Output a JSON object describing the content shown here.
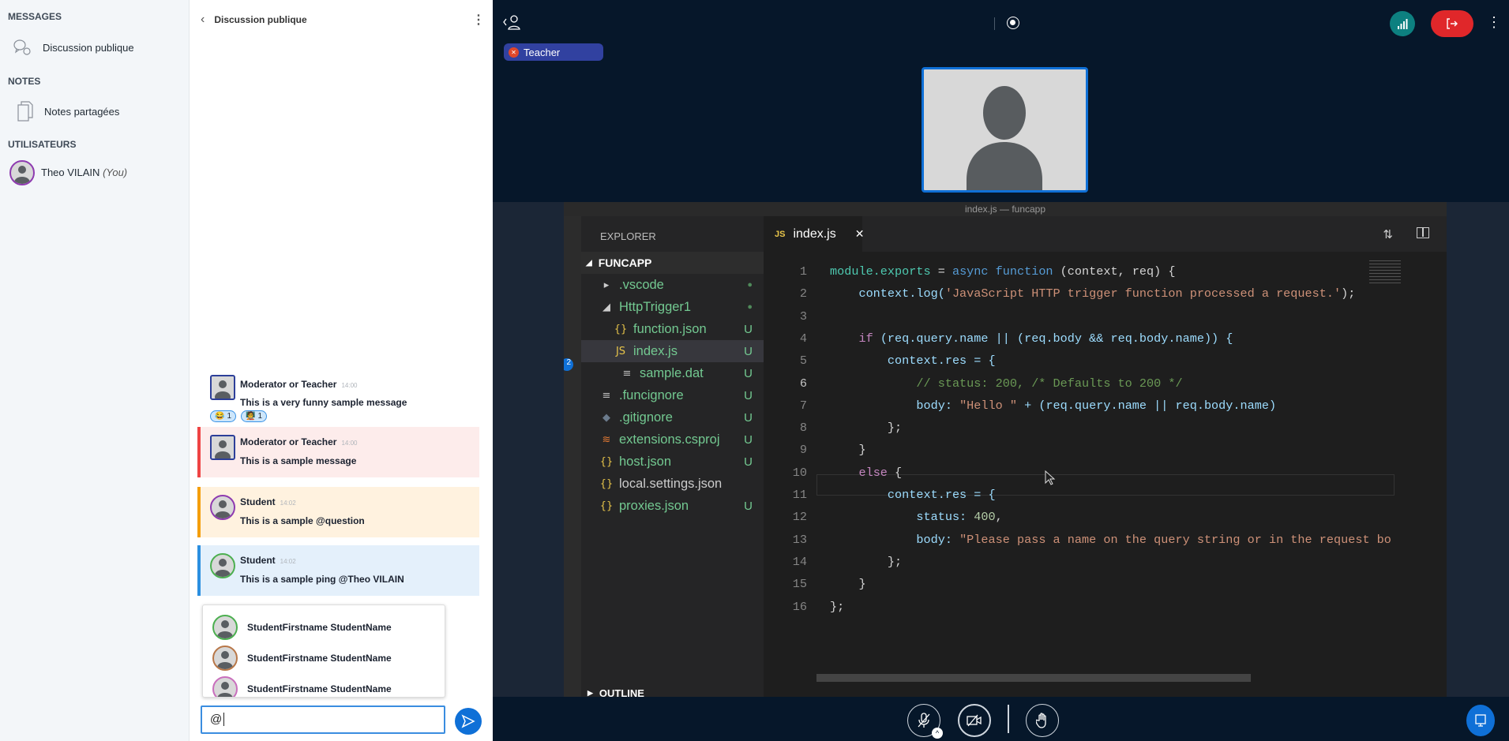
{
  "sidebar": {
    "messages_heading": "MESSAGES",
    "public_chat": "Discussion publique",
    "notes_heading": "NOTES",
    "shared_notes": "Notes partagées",
    "users_heading": "UTILISATEURS",
    "user_name": "Theo VILAIN",
    "user_you": "(You)"
  },
  "chat": {
    "title": "Discussion publique",
    "messages": [
      {
        "author": "Moderator or Teacher",
        "time": "14:00",
        "text": "This is a very funny sample message",
        "reactions": [
          {
            "emoji": "😂",
            "count": "1"
          },
          {
            "emoji": "🧑‍🏫",
            "count": "1"
          }
        ]
      },
      {
        "author": "Moderator or Teacher",
        "time": "14:00",
        "text": "This is a sample message"
      },
      {
        "author": "Student",
        "time": "14:02",
        "text": "This is a sample @question"
      },
      {
        "author": "Student",
        "time": "14:02",
        "text": "This is a sample ping @Theo VILAIN"
      }
    ],
    "mentions": [
      "StudentFirstname StudentName",
      "StudentFirstname StudentName",
      "StudentFirstname StudentName"
    ],
    "input_value": "@"
  },
  "colors": {
    "accent": "#0f70d7",
    "leave": "#e0272a",
    "signal": "#0d8080",
    "teacher_pill": "#3141a0",
    "msg_teacher_bg": "#fdeceb",
    "msg_teacher_border": "#ef4444",
    "msg_question_bg": "#fff2df",
    "msg_question_border": "#f59e0b",
    "msg_ping_bg": "#e4f0fb",
    "msg_ping_border": "#2b8fe0"
  },
  "meeting": {
    "presenter_label": "Teacher"
  },
  "vscode": {
    "title": "index.js — funcapp",
    "explorer": "EXPLORER",
    "project": "FUNCAPP",
    "outline": "OUTLINE",
    "tab": "index.js",
    "tab_icon": "JS",
    "files": [
      {
        "name": ".vscode",
        "icon": "▸",
        "status": "●"
      },
      {
        "name": "HttpTrigger1",
        "icon": "◢",
        "status": "●"
      },
      {
        "name": "function.json",
        "icon": "{}",
        "status": "U"
      },
      {
        "name": "index.js",
        "icon": "JS",
        "status": "U"
      },
      {
        "name": "sample.dat",
        "icon": "≡",
        "status": "U"
      },
      {
        "name": ".funcignore",
        "icon": "≡",
        "status": "U"
      },
      {
        "name": ".gitignore",
        "icon": "◆",
        "status": "U"
      },
      {
        "name": "extensions.csproj",
        "icon": "≋",
        "status": "U"
      },
      {
        "name": "host.json",
        "icon": "{}",
        "status": "U"
      },
      {
        "name": "local.settings.json",
        "icon": "{}",
        "status": ""
      },
      {
        "name": "proxies.json",
        "icon": "{}",
        "status": "U"
      }
    ],
    "active_line": 6,
    "code": [
      [
        [
          "module.exports",
          "t"
        ],
        [
          " = ",
          "p"
        ],
        [
          "async function",
          "k"
        ],
        [
          " (context, req) {",
          "p"
        ]
      ],
      [
        [
          "    context.log(",
          ""
        ],
        [
          "'JavaScript HTTP trigger function processed a request.'",
          "s"
        ],
        [
          ");",
          "p"
        ]
      ],
      [],
      [
        [
          "    ",
          "p"
        ],
        [
          "if",
          "c"
        ],
        [
          " (req.query.name || (req.body && req.body.name)) {",
          ""
        ]
      ],
      [
        [
          "        context.res = {",
          ""
        ]
      ],
      [
        [
          "            // status: 200, /* Defaults to 200 */",
          "cm"
        ]
      ],
      [
        [
          "            body: ",
          ""
        ],
        [
          "\"Hello \"",
          "s"
        ],
        [
          " + (req.query.name || req.body.name)",
          ""
        ]
      ],
      [
        [
          "        };",
          "p"
        ]
      ],
      [
        [
          "    }",
          "p"
        ]
      ],
      [
        [
          "    ",
          "p"
        ],
        [
          "else",
          "c"
        ],
        [
          " {",
          "p"
        ]
      ],
      [
        [
          "        context.res = {",
          ""
        ]
      ],
      [
        [
          "            status: ",
          ""
        ],
        [
          "400",
          "n"
        ],
        [
          ",",
          "p"
        ]
      ],
      [
        [
          "            body: ",
          ""
        ],
        [
          "\"Please pass a name on the query string or in the request bo",
          "s"
        ]
      ],
      [
        [
          "        };",
          "p"
        ]
      ],
      [
        [
          "    }",
          "p"
        ]
      ],
      [
        [
          "};",
          "p"
        ]
      ]
    ]
  }
}
